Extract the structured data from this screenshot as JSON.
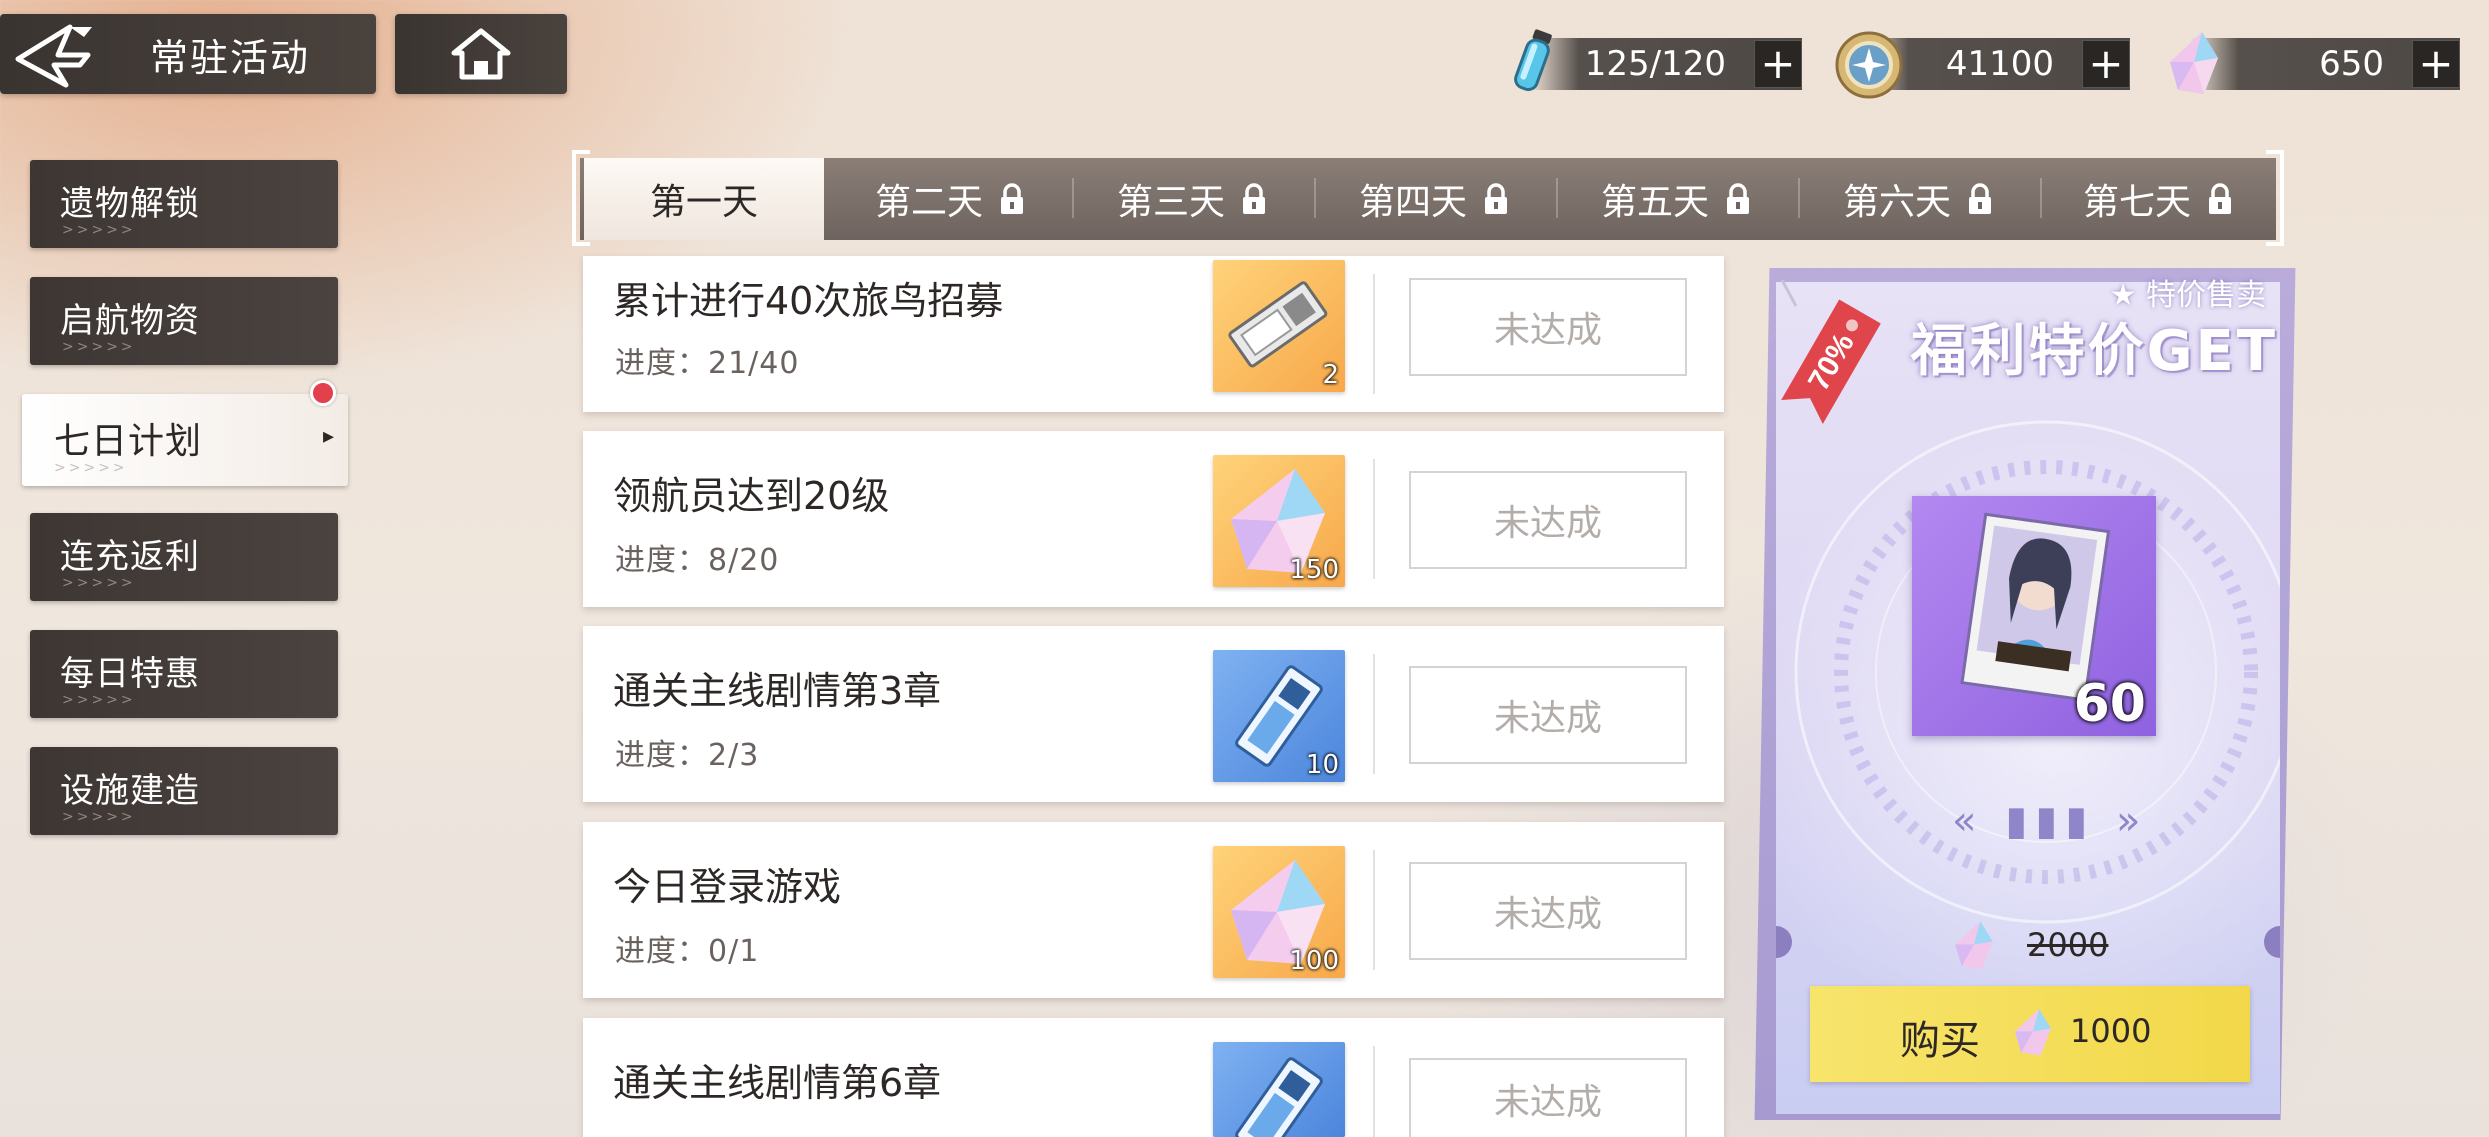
{
  "header": {
    "title": "常驻活动",
    "back_icon": "back-arrow-icon",
    "home_icon": "home-icon"
  },
  "resources": {
    "stamina": {
      "value": "125/120",
      "icon": "stamina-vial-icon"
    },
    "coins": {
      "value": "41100",
      "icon": "coin-icon"
    },
    "crystals": {
      "value": "650",
      "icon": "crystal-icon"
    },
    "plus": "+"
  },
  "sidebar": {
    "items": [
      {
        "label": "遗物解锁",
        "dots": ">>>>>"
      },
      {
        "label": "启航物资",
        "dots": ">>>>>"
      },
      {
        "label": "七日计划",
        "dots": ">>>>>",
        "active": true,
        "has_notice": true
      },
      {
        "label": "连充返利",
        "dots": ">>>>>"
      },
      {
        "label": "每日特惠",
        "dots": ">>>>>"
      },
      {
        "label": "设施建造",
        "dots": ">>>>>"
      }
    ],
    "arrow": "▸"
  },
  "tabs": [
    {
      "label": "第一天",
      "locked": false,
      "active": true
    },
    {
      "label": "第二天",
      "locked": true
    },
    {
      "label": "第三天",
      "locked": true
    },
    {
      "label": "第四天",
      "locked": true
    },
    {
      "label": "第五天",
      "locked": true
    },
    {
      "label": "第六天",
      "locked": true
    },
    {
      "label": "第七天",
      "locked": true
    }
  ],
  "tasks": [
    {
      "title": "累计进行40次旅鸟招募",
      "progress": "进度：21/40",
      "reward_icon": "recruit-ticket-icon",
      "reward_count": "2",
      "status": "未达成"
    },
    {
      "title": "领航员达到20级",
      "progress": "进度：8/20",
      "reward_icon": "crystal-icon",
      "reward_count": "150",
      "status": "未达成"
    },
    {
      "title": "通关主线剧情第3章",
      "progress": "进度：2/3",
      "reward_icon": "blue-ticket-icon",
      "reward_count": "10",
      "status": "未达成"
    },
    {
      "title": "今日登录游戏",
      "progress": "进度：0/1",
      "reward_icon": "crystal-icon",
      "reward_count": "100",
      "status": "未达成"
    },
    {
      "title": "通关主线剧情第6章",
      "reward_icon": "blue-ticket-icon",
      "status": "未达成"
    }
  ],
  "promo": {
    "tag": "70%",
    "subtitle": "★ 特价售卖",
    "title": "福利特价GET",
    "item_icon": "character-portrait-card-icon",
    "item_count": "60",
    "pager": "«  ▮▮▮  »",
    "old_price": "2000",
    "buy_label": "购买",
    "buy_price": "1000"
  },
  "colors": {
    "menu_dark": "#3d3633",
    "tab_bar": "#7a6f69",
    "reward_gold": "#f7a84a",
    "reward_blue": "#4c85dc",
    "buy_yellow": "#f2d849",
    "notice_red": "#e2404a"
  }
}
